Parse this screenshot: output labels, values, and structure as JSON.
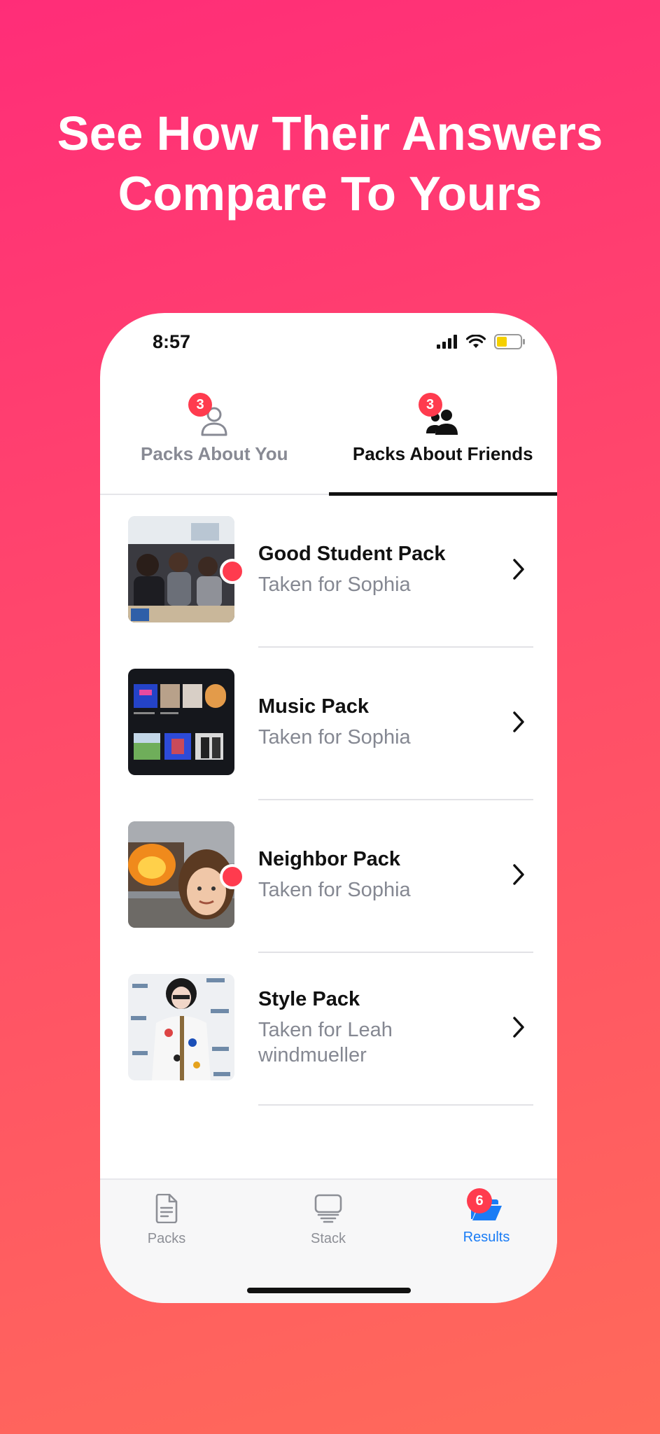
{
  "headline": {
    "line1": "See How Their Answers",
    "line2": "Compare To Yours"
  },
  "status": {
    "time": "8:57"
  },
  "tabs": {
    "about_you": {
      "label": "Packs About You",
      "badge": "3"
    },
    "about_friends": {
      "label": "Packs About Friends",
      "badge": "3"
    }
  },
  "packs": [
    {
      "title": "Good Student Pack",
      "subtitle": "Taken for Sophia",
      "unread": true
    },
    {
      "title": "Music Pack",
      "subtitle": "Taken for Sophia",
      "unread": false
    },
    {
      "title": "Neighbor Pack",
      "subtitle": "Taken for Sophia",
      "unread": true
    },
    {
      "title": "Style Pack",
      "subtitle": "Taken for Leah windmueller",
      "unread": false
    }
  ],
  "tabbar": {
    "packs": {
      "label": "Packs",
      "icon": "document-icon"
    },
    "stack": {
      "label": "Stack",
      "icon": "stack-icon"
    },
    "results": {
      "label": "Results",
      "icon": "folder-open-icon",
      "badge": "6"
    }
  },
  "colors": {
    "accent": "#1a7cf5",
    "badge": "#ff3b4e"
  }
}
